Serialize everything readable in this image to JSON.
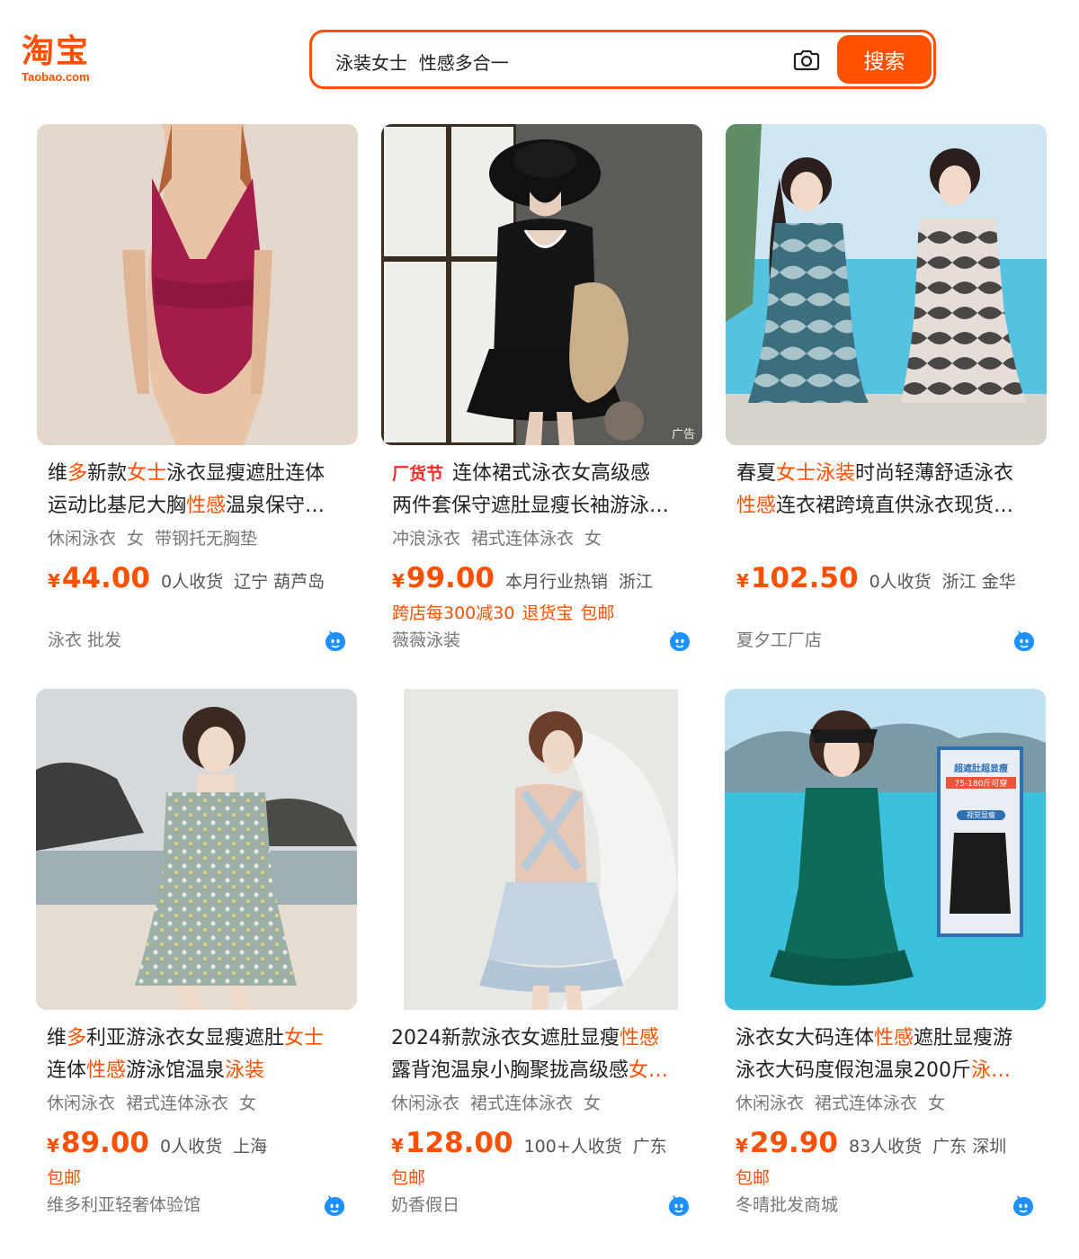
{
  "header": {
    "logo_text": "淘宝",
    "logo_sub": "Taobao.com",
    "search_value": "泳装女士  性感多合一",
    "search_button": "搜索"
  },
  "products": [
    {
      "title_line1": [
        {
          "t": "维"
        },
        {
          "t": "多",
          "hl": true
        },
        {
          "t": "新款"
        },
        {
          "t": "女士",
          "hl": true
        },
        {
          "t": "泳衣显瘦遮肚连体"
        }
      ],
      "title_line2": [
        {
          "t": "运动比基尼大胸"
        },
        {
          "t": "性感",
          "hl": true
        },
        {
          "t": "温泉保守…"
        }
      ],
      "tags": [
        "休闲泳衣",
        "女",
        "带钢托无胸垫"
      ],
      "currency": "¥",
      "price": "44.00",
      "sold": "0人收货",
      "location": "辽宁 葫芦岛",
      "extras": [],
      "shop": "泳衣 批发"
    },
    {
      "promo": "厂货节",
      "title_line1": [
        {
          "t": "连体裙式泳衣女高级感"
        }
      ],
      "title_line2": [
        {
          "t": "两件套保守遮肚显瘦长袖游泳…"
        }
      ],
      "tags": [
        "冲浪泳衣",
        "裙式连体泳衣",
        "女"
      ],
      "currency": "¥",
      "price": "99.00",
      "sold": "本月行业热销",
      "location": "浙江",
      "extras": [
        "跨店每300减30",
        "退货宝",
        "包邮"
      ],
      "shop": "薇薇泳装",
      "ad": "广告"
    },
    {
      "title_line1": [
        {
          "t": "春夏"
        },
        {
          "t": "女士泳装",
          "hl": true
        },
        {
          "t": "时尚轻薄舒适泳衣"
        }
      ],
      "title_line2": [
        {
          "t": "性感",
          "hl": true
        },
        {
          "t": "连衣裙跨境直供泳衣现货…"
        }
      ],
      "tags": [],
      "currency": "¥",
      "price": "102.50",
      "sold": "0人收货",
      "location": "浙江 金华",
      "extras": [],
      "shop": "夏夕工厂店"
    },
    {
      "title_line1": [
        {
          "t": "维"
        },
        {
          "t": "多",
          "hl": true
        },
        {
          "t": "利亚游泳衣女显瘦遮肚"
        },
        {
          "t": "女士",
          "hl": true
        }
      ],
      "title_line2": [
        {
          "t": "连体"
        },
        {
          "t": "性感",
          "hl": true
        },
        {
          "t": "游泳馆温泉"
        },
        {
          "t": "泳装",
          "hl": true
        }
      ],
      "tags": [
        "休闲泳衣",
        "裙式连体泳衣",
        "女"
      ],
      "currency": "¥",
      "price": "89.00",
      "sold": "0人收货",
      "location": "上海",
      "extras": [
        "包邮"
      ],
      "shop": "维多利亚轻奢体验馆"
    },
    {
      "title_line1": [
        {
          "t": "2024新款泳衣女遮肚显瘦"
        },
        {
          "t": "性感",
          "hl": true
        }
      ],
      "title_line2": [
        {
          "t": "露背泡温泉小胸聚拢高级感"
        },
        {
          "t": "女…",
          "hl": true
        }
      ],
      "tags": [
        "休闲泳衣",
        "裙式连体泳衣",
        "女"
      ],
      "currency": "¥",
      "price": "128.00",
      "sold": "100+人收货",
      "location": "广东",
      "extras": [
        "包邮"
      ],
      "shop": "奶香假日"
    },
    {
      "title_line1": [
        {
          "t": "泳衣女大码连体"
        },
        {
          "t": "性感",
          "hl": true
        },
        {
          "t": "遮肚显瘦游"
        }
      ],
      "title_line2": [
        {
          "t": "泳衣大码度假泡温泉200斤"
        },
        {
          "t": "泳…",
          "hl": true
        }
      ],
      "tags": [
        "休闲泳衣",
        "裙式连体泳衣",
        "女"
      ],
      "currency": "¥",
      "price": "29.90",
      "sold": "83人收货",
      "location": "广东 深圳",
      "extras": [
        "包邮"
      ],
      "shop": "冬晴批发商城",
      "inset_title": "超遮肚超显瘦",
      "inset_sub": "75-180斤可穿",
      "inset_tag": "视觉显瘦"
    }
  ],
  "colors": {
    "accent": "#ff5000",
    "promo": "#ff2a2a",
    "wangwang": "#1e90ff"
  }
}
